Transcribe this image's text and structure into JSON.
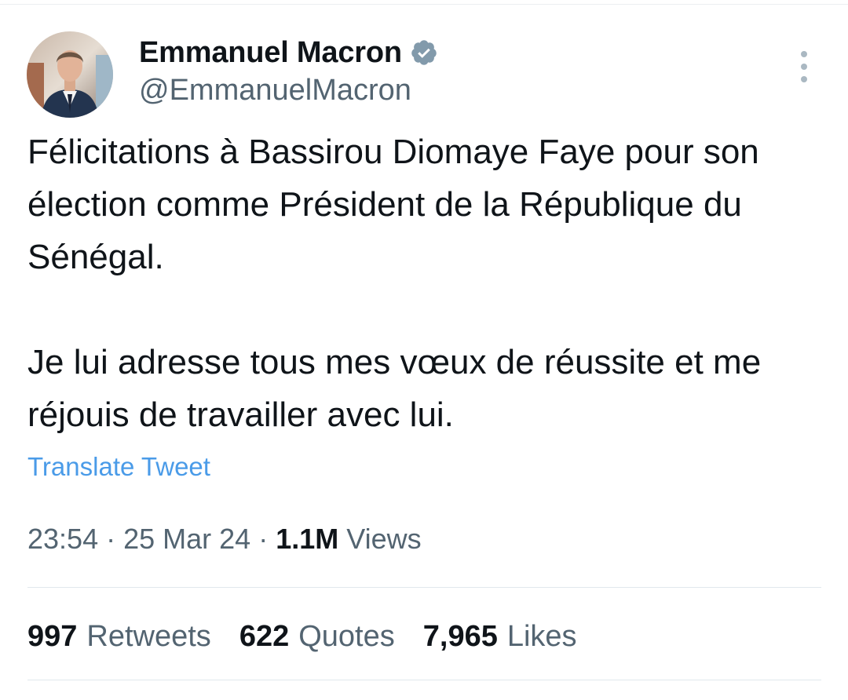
{
  "author": {
    "display_name": "Emmanuel Macron",
    "handle": "@EmmanuelMacron",
    "verified": true,
    "avatar_icon": "profile-photo-avatar"
  },
  "tweet": {
    "paragraphs": [
      "Félicitations à Bassirou Diomaye Faye pour son élection comme Président de la République du Sénégal.",
      "Je lui adresse tous mes vœux de réussite et me réjouis de travailler avec lui."
    ],
    "translate_label": "Translate Tweet"
  },
  "meta": {
    "time": "23:54",
    "date": "25 Mar 24",
    "separator": "·",
    "views_count": "1.1M",
    "views_label": "Views"
  },
  "stats": {
    "retweets_count": "997",
    "retweets_label": "Retweets",
    "quotes_count": "622",
    "quotes_label": "Quotes",
    "likes_count": "7,965",
    "likes_label": "Likes"
  },
  "colors": {
    "text": "#0f1419",
    "secondary": "#536471",
    "link": "#4a9be8",
    "verified_badge": "#829aab",
    "divider": "#e1e8ed"
  }
}
